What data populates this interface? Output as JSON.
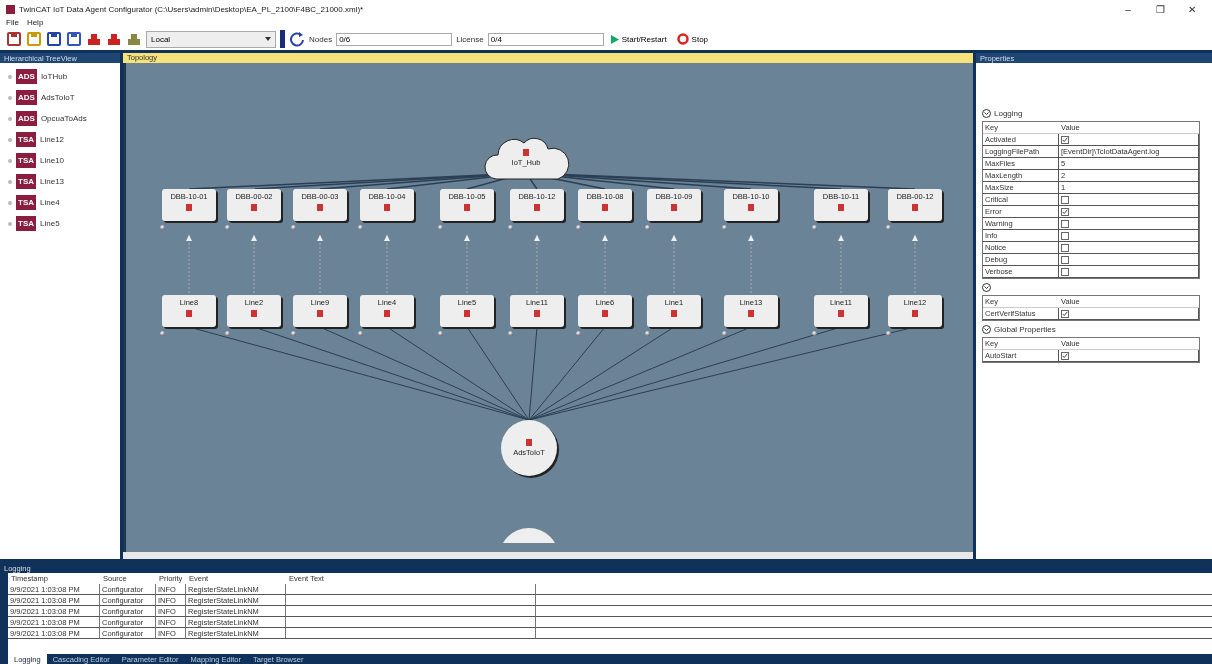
{
  "window": {
    "title": "TwinCAT IoT Data Agent Configurator (C:\\Users\\admin\\Desktop\\EA_PL_2100\\F4BC_21000.xml)*",
    "controls": [
      "–",
      "❐",
      "✕"
    ]
  },
  "menu": [
    "File",
    "Help"
  ],
  "toolbar": {
    "target": "Local",
    "nodes_label": "Nodes",
    "nodes_value": "0/6",
    "license_label": "License",
    "license_value": "0/4",
    "start": "Start/Restart",
    "stop": "Stop"
  },
  "tree": {
    "title": "Hierarchical TreeView",
    "items": [
      {
        "badge": "ADS",
        "label": "IoTHub"
      },
      {
        "badge": "ADS",
        "label": "AdsToIoT"
      },
      {
        "badge": "ADS",
        "label": "OpcuaToAds"
      },
      {
        "badge": "TSA",
        "label": "Line12"
      },
      {
        "badge": "TSA",
        "label": "Line10"
      },
      {
        "badge": "TSA",
        "label": "Line13"
      },
      {
        "badge": "TSA",
        "label": "Line4"
      },
      {
        "badge": "TSA",
        "label": "Line5"
      }
    ]
  },
  "topology": {
    "title": "Topology",
    "cloud": "IoT_Hub",
    "hub": "AdsToIoT",
    "upper": [
      "DBB-10-01",
      "DBB-00-02",
      "DBB-00-03",
      "DBB-10-04",
      "DBB-10-05",
      "DBB-10-12",
      "DBB-10-08",
      "DBB-10-09",
      "DBB-10-10",
      "DBB-10-11",
      "DBB-00-12"
    ],
    "lower": [
      "Line8",
      "Line2",
      "Line9",
      "Line4",
      "Line5",
      "Line11",
      "Line6",
      "Line1",
      "Line13",
      "Line11",
      "Line12"
    ]
  },
  "properties": {
    "title": "Properties",
    "groups": [
      {
        "title": "Logging",
        "key": "Key",
        "value": "Value",
        "rows": [
          {
            "key": "Activated",
            "kind": "check",
            "checked": true
          },
          {
            "key": "LoggingFilePath",
            "kind": "text",
            "value": "[EventDir]\\TcIotDataAgent.log"
          },
          {
            "key": "MaxFiles",
            "kind": "text",
            "value": "5"
          },
          {
            "key": "MaxLength",
            "kind": "text",
            "value": "2"
          },
          {
            "key": "MaxSize",
            "kind": "text",
            "value": "1"
          },
          {
            "key": "Critical",
            "kind": "check",
            "checked": false
          },
          {
            "key": "Error",
            "kind": "check",
            "checked": true
          },
          {
            "key": "Warning",
            "kind": "check",
            "checked": false
          },
          {
            "key": "Info",
            "kind": "check",
            "checked": false
          },
          {
            "key": "Notice",
            "kind": "check",
            "checked": false
          },
          {
            "key": "Debug",
            "kind": "check",
            "checked": false
          },
          {
            "key": "Verbose",
            "kind": "check",
            "checked": false
          }
        ]
      },
      {
        "key": "Key",
        "value": "Value",
        "rows": [
          {
            "key": "CertVerifStatus",
            "kind": "check",
            "checked": true
          }
        ]
      },
      {
        "title": "Global Properties",
        "key": "Key",
        "value": "Value",
        "rows": [
          {
            "key": "AutoStart",
            "kind": "check",
            "checked": true
          }
        ]
      }
    ]
  },
  "logging": {
    "title": "Logging",
    "columns": [
      "Timestamp",
      "Source",
      "Priority",
      "Event",
      "Event Text"
    ],
    "rows": [
      [
        "9/9/2021 1:03:08 PM",
        "Configurator",
        "INFO",
        "RegisterStateLinkNM"
      ],
      [
        "9/9/2021 1:03:08 PM",
        "Configurator",
        "INFO",
        "RegisterStateLinkNM"
      ],
      [
        "9/9/2021 1:03:08 PM",
        "Configurator",
        "INFO",
        "RegisterStateLinkNM"
      ],
      [
        "9/9/2021 1:03:08 PM",
        "Configurator",
        "INFO",
        "RegisterStateLinkNM"
      ],
      [
        "9/9/2021 1:03:08 PM",
        "Configurator",
        "INFO",
        "RegisterStateLinkNM"
      ]
    ],
    "tabs": [
      {
        "label": "Logging",
        "selected": true
      },
      {
        "label": "Cascading Editor",
        "selected": false
      },
      {
        "label": "Parameter Editor",
        "selected": false
      },
      {
        "label": "Mapping Editor",
        "selected": false
      },
      {
        "label": "Target Browser",
        "selected": false
      }
    ]
  }
}
